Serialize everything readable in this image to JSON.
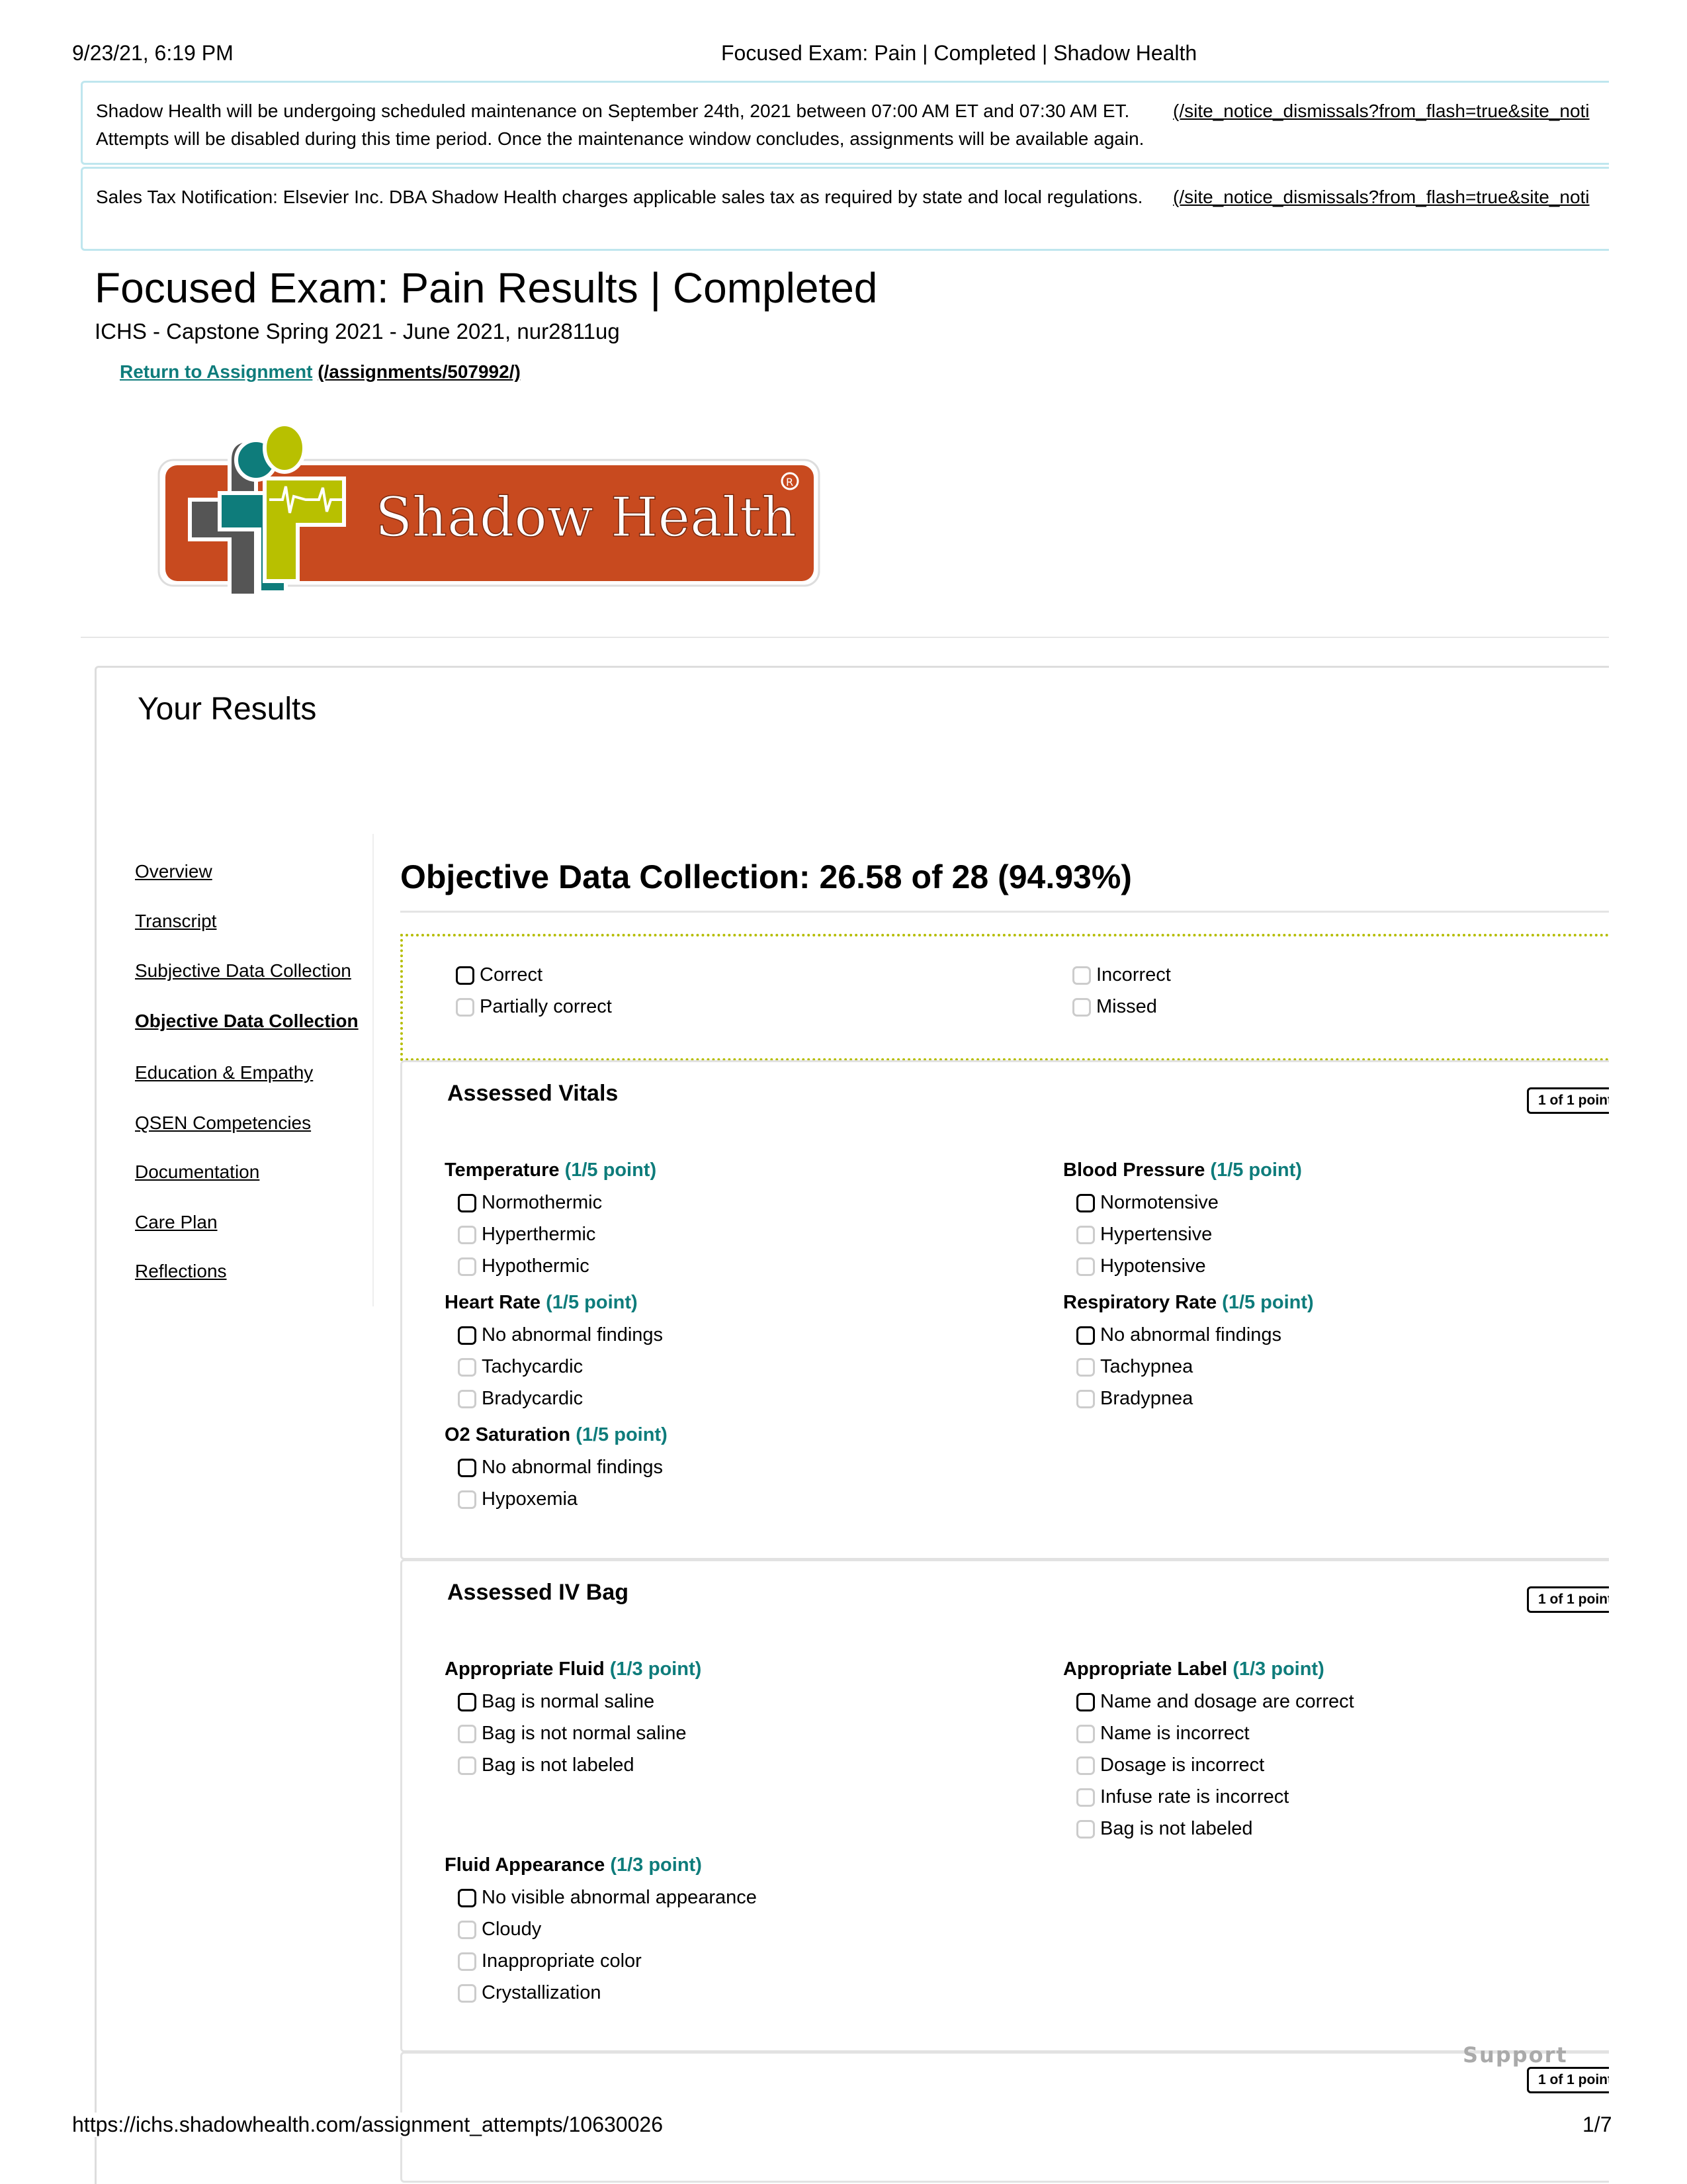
{
  "print_header": {
    "datetime": "9/23/21, 6:19 PM",
    "doc_title": "Focused Exam: Pain | Completed | Shadow Health"
  },
  "notices": [
    {
      "text": "Shadow Health will be undergoing scheduled maintenance on September 24th, 2021 between 07:00 AM ET and 07:30 AM ET. Attempts will be disabled during this time period. Once the maintenance window concludes, assignments will be available again.",
      "link": "(/site_notice_dismissals?from_flash=true&site_noti"
    },
    {
      "text": "Sales Tax Notification: Elsevier Inc. DBA Shadow Health charges applicable sales tax as required by state and local regulations.",
      "link": "(/site_notice_dismissals?from_flash=true&site_noti"
    }
  ],
  "page": {
    "title": "Focused Exam: Pain Results | Completed",
    "subtitle": "ICHS - Capstone Spring 2021 - June 2021, nur2811ug",
    "return_link": "Return to Assignment",
    "return_path": "(/assignments/507992/)",
    "logo_text": "Shadow Health"
  },
  "results": {
    "heading": "Your Results",
    "sidebar": [
      "Overview",
      "Transcript",
      "Subjective Data Collection",
      "Objective Data Collection",
      "Education & Empathy",
      "QSEN Competencies",
      "Documentation",
      "Care Plan",
      "Reflections"
    ],
    "active_index": 3,
    "section_title": "Objective Data Collection: 26.58 of 28 (94.93%)",
    "legend": [
      {
        "label": "Correct",
        "selected": true
      },
      {
        "label": "Partially correct",
        "selected": false
      },
      {
        "label": "Incorrect",
        "selected": false
      },
      {
        "label": "Missed",
        "selected": false
      }
    ],
    "accent_color": "#0e7c7b",
    "legend_border_color": "#b5bd00",
    "sections": [
      {
        "title": "Assessed Vitals",
        "badge": "1 of 1 point",
        "groups": [
          {
            "label": "Temperature",
            "points": "(1/5 point)",
            "items": [
              "Normothermic",
              "Hyperthermic",
              "Hypothermic"
            ]
          },
          {
            "label": "Blood Pressure",
            "points": "(1/5 point)",
            "items": [
              "Normotensive",
              "Hypertensive",
              "Hypotensive"
            ]
          },
          {
            "label": "Heart Rate",
            "points": "(1/5 point)",
            "items": [
              "No abnormal findings",
              "Tachycardic",
              "Bradycardic"
            ]
          },
          {
            "label": "Respiratory Rate",
            "points": "(1/5 point)",
            "items": [
              "No abnormal findings",
              "Tachypnea",
              "Bradypnea"
            ]
          },
          {
            "label": "O2 Saturation",
            "points": "(1/5 point)",
            "items": [
              "No abnormal findings",
              "Hypoxemia"
            ]
          }
        ]
      },
      {
        "title": "Assessed IV Bag",
        "badge": "1 of 1 point",
        "groups": [
          {
            "label": "Appropriate Fluid",
            "points": "(1/3 point)",
            "items": [
              "Bag is normal saline",
              "Bag is not normal saline",
              "Bag is not labeled"
            ]
          },
          {
            "label": "Appropriate Label",
            "points": "(1/3 point)",
            "items": [
              "Name and dosage are correct",
              "Name is incorrect",
              "Dosage is incorrect",
              "Infuse rate is incorrect",
              "Bag is not labeled"
            ]
          },
          {
            "label": "Fluid Appearance",
            "points": "(1/3 point)",
            "items": [
              "No visible abnormal appearance",
              "Cloudy",
              "Inappropriate color",
              "Crystallization"
            ]
          }
        ]
      },
      {
        "title": "",
        "badge": "1 of 1 point",
        "groups": []
      }
    ],
    "support_label": "Support"
  },
  "print_footer": {
    "url": "https://ichs.shadowhealth.com/assignment_attempts/10630026",
    "page": "1/7"
  }
}
